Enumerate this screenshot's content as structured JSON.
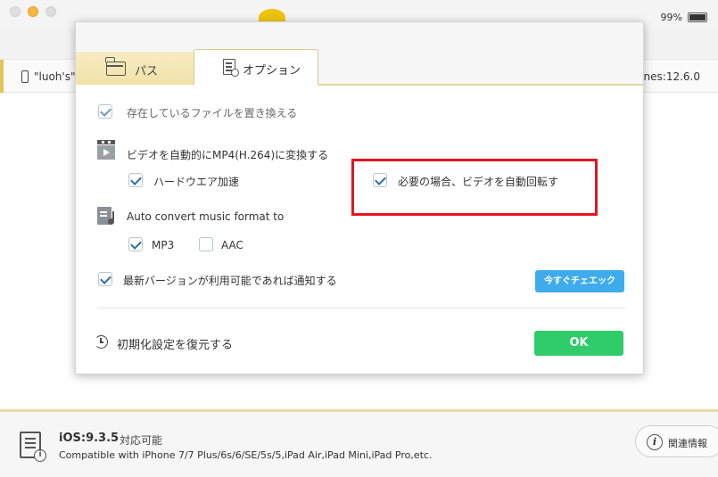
{
  "app": {
    "battery": "99%",
    "device_name": "\"luoh's\"",
    "itunes_version": "nes:12.6.0"
  },
  "footer": {
    "ios_version": "iOS:9.3.5",
    "ios_supported": "対応可能",
    "compatibility": "Compatible with iPhone 7/7 Plus/6s/6/SE/5s/5,iPad Air,iPad Mini,iPad Pro,etc.",
    "related_info": "関連情報"
  },
  "dialog": {
    "tabs": [
      {
        "label": "パス",
        "active": false
      },
      {
        "label": "オプション",
        "active": true
      }
    ],
    "options": {
      "replace_existing": {
        "label": "存在しているファイルを置き換える",
        "checked": true
      },
      "video_convert": {
        "label": "ビデオを自動的にMP4(H.264)に変換する"
      },
      "hardware_accel": {
        "label": "ハードウエア加速",
        "checked": true
      },
      "auto_rotate": {
        "label": "必要の場合、ビデオを自動回転す",
        "checked": true
      },
      "music_convert": {
        "label": "Auto convert music format to"
      },
      "mp3": {
        "label": "MP3",
        "checked": true
      },
      "aac": {
        "label": "AAC",
        "checked": false
      },
      "notify_update": {
        "label": "最新バージョンが利用可能であれば通知する",
        "checked": true
      }
    },
    "check_now_button": "今すぐチェエック",
    "restore_defaults": "初期化設定を復元する",
    "ok_button": "OK"
  },
  "colors": {
    "ok_button": "#2fcc6a",
    "check_button": "#3eacec",
    "highlight": "#e2161f",
    "tab_accent": "#f1e2a8"
  }
}
